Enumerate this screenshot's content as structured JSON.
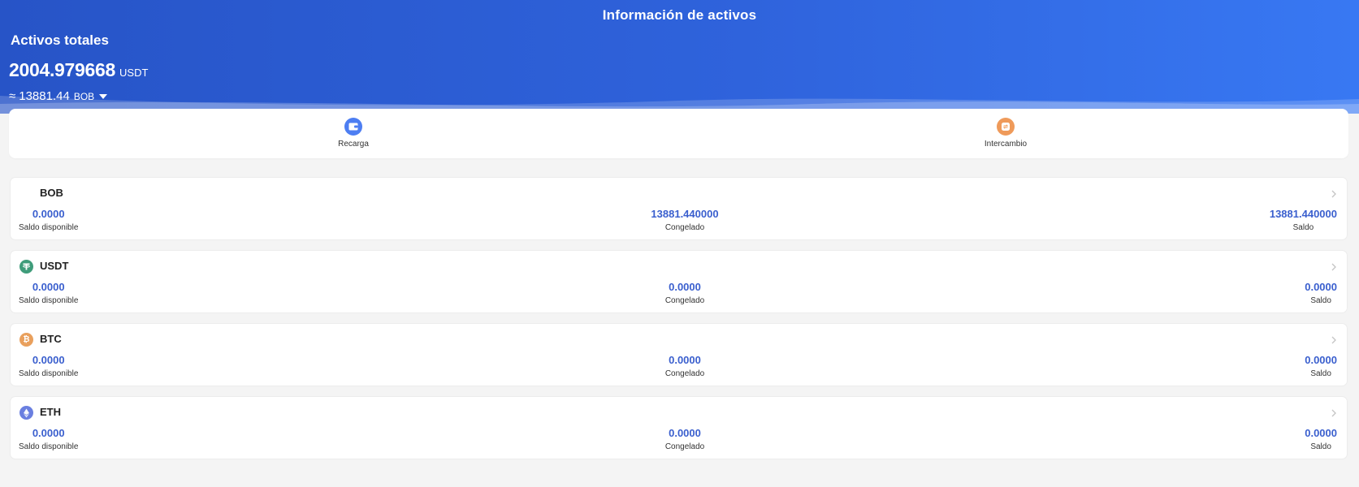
{
  "header": {
    "title": "Información de activos"
  },
  "summary": {
    "total_label": "Activos totales",
    "total_value": "2004.979668",
    "total_unit": "USDT",
    "approx_symbol": "≈",
    "approx_value": "13881.44",
    "approx_unit": "BOB"
  },
  "actions": [
    {
      "label": "Recarga",
      "icon": "wallet-icon",
      "color": "#4d7ef2"
    },
    {
      "label": "Intercambio",
      "icon": "exchange-icon",
      "color": "#ef9a5a"
    }
  ],
  "assets": [
    {
      "name": "BOB",
      "icon": "none",
      "available": "0.0000",
      "frozen": "13881.440000",
      "balance": "13881.440000"
    },
    {
      "name": "USDT",
      "icon": "tether-icon",
      "icon_color": "#3f9c7a",
      "available": "0.0000",
      "frozen": "0.0000",
      "balance": "0.0000"
    },
    {
      "name": "BTC",
      "icon": "bitcoin-icon",
      "icon_color": "#e9a05d",
      "available": "0.0000",
      "frozen": "0.0000",
      "balance": "0.0000"
    },
    {
      "name": "ETH",
      "icon": "ethereum-icon",
      "icon_color": "#6a7fe0",
      "available": "0.0000",
      "frozen": "0.0000",
      "balance": "0.0000"
    }
  ],
  "labels": {
    "available": "Saldo disponible",
    "frozen": "Congelado",
    "balance": "Saldo"
  },
  "colors": {
    "accent": "#3a5fce",
    "hero_start": "#2754c7",
    "hero_end": "#3878f3"
  }
}
